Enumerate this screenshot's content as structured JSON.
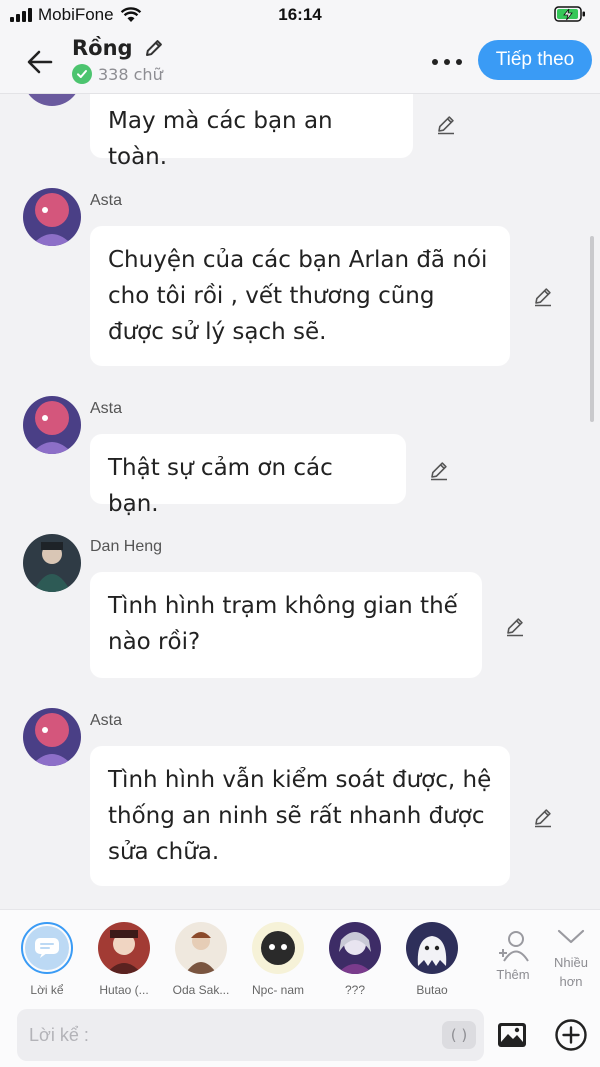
{
  "status_bar": {
    "carrier": "MobiFone",
    "time": "16:14"
  },
  "header": {
    "title": "Rồng",
    "word_count": "338 chữ",
    "next_label": "Tiếp theo"
  },
  "messages": [
    {
      "text": "May mà các bạn an toàn."
    },
    {
      "speaker": "Asta",
      "text": "Chuyện của các bạn Arlan đã nói cho tôi rồi , vết thương cũng được sử lý sạch sẽ."
    },
    {
      "speaker": "Asta",
      "text": "Thật sự cảm ơn các bạn."
    },
    {
      "speaker": "Dan Heng",
      "text": "Tình hình trạm không gian thế nào rồi?"
    },
    {
      "speaker": "Asta",
      "text": "Tình hình vẫn kiểm soát được, hệ thống an ninh sẽ rất nhanh được sửa chữa."
    }
  ],
  "characters": [
    {
      "label": "Lời kể"
    },
    {
      "label": "Hutao (..."
    },
    {
      "label": "Oda Sak..."
    },
    {
      "label": "Npc- nam"
    },
    {
      "label": "???"
    },
    {
      "label": "Butao"
    }
  ],
  "actions": {
    "add_label": "Thêm",
    "more_label": "Nhiều hơn"
  },
  "input": {
    "placeholder": "Lời kể :",
    "paren": "( )"
  },
  "colors": {
    "accent": "#3a9bf5",
    "check": "#4cc46f",
    "background": "#f2f2f4"
  }
}
